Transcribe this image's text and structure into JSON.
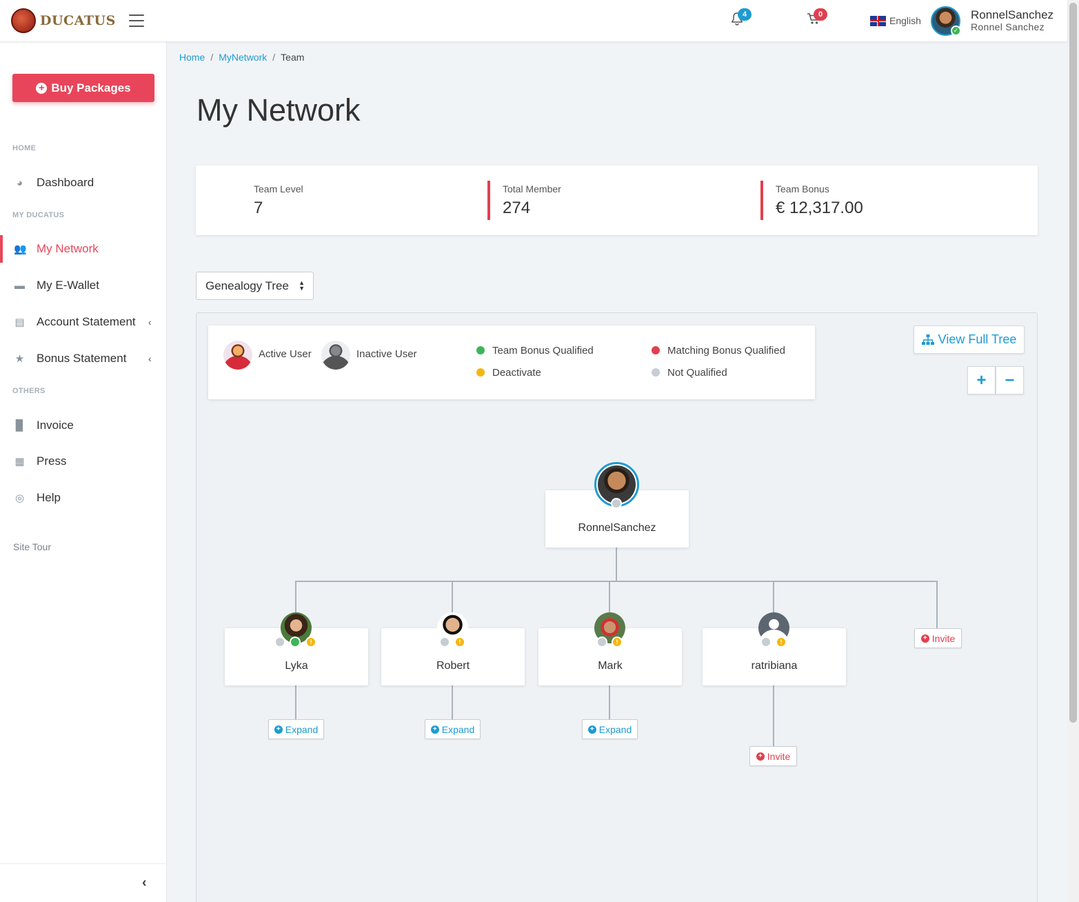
{
  "header": {
    "logo_text": "DUCATUS",
    "notifications_count": "4",
    "cart_count": "0",
    "language": "English",
    "username": "RonnelSanchez",
    "fullname": "Ronnel Sanchez"
  },
  "sidebar": {
    "buy_label": "Buy Packages",
    "sections": {
      "home": "HOME",
      "my_ducatus": "MY DUCATUS",
      "others": "OTHERS"
    },
    "items": {
      "dashboard": "Dashboard",
      "my_network": "My Network",
      "ewallet": "My E-Wallet",
      "account_statement": "Account Statement",
      "bonus_statement": "Bonus Statement",
      "invoice": "Invoice",
      "press": "Press",
      "help": "Help"
    },
    "site_tour": "Site Tour"
  },
  "breadcrumb": [
    "Home",
    "MyNetwork",
    "Team"
  ],
  "page_title": "My Network",
  "stats": {
    "team_level_label": "Team Level",
    "team_level_value": "7",
    "total_member_label": "Total Member",
    "total_member_value": "274",
    "team_bonus_label": "Team Bonus",
    "team_bonus_value": "€ 12,317.00"
  },
  "view_select": "Genealogy Tree",
  "legend": {
    "active_user": "Active User",
    "inactive_user": "Inactive User",
    "team_bonus_qualified": "Team Bonus Qualified",
    "matching_bonus_qualified": "Matching Bonus Qualified",
    "deactivate": "Deactivate",
    "not_qualified": "Not Qualified"
  },
  "view_full_tree": "View Full Tree",
  "tree": {
    "root": "RonnelSanchez",
    "children": [
      "Lyka",
      "Robert",
      "Mark",
      "ratribiana"
    ],
    "expand_label": "Expand",
    "invite_label": "Invite"
  },
  "colors": {
    "accent_blue": "#1e9bd1",
    "accent_red": "#e8455a",
    "status_green": "#3cb55a",
    "status_yellow": "#f5b60d",
    "status_grey": "#c6cdd3"
  }
}
